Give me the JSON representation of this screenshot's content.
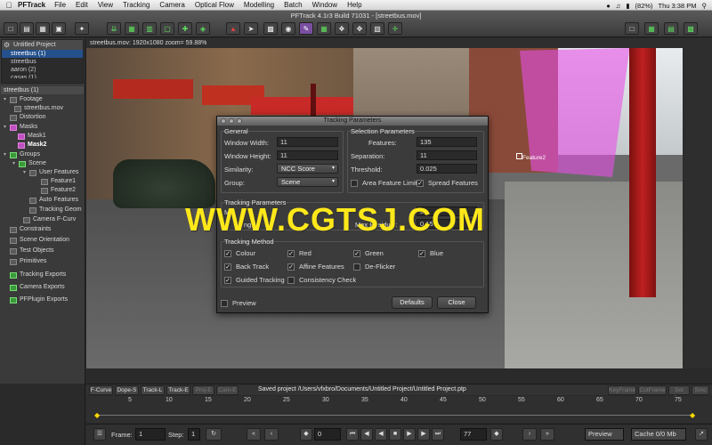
{
  "menubar": {
    "app": "PFTrack",
    "items": [
      "File",
      "Edit",
      "View",
      "Tracking",
      "Camera",
      "Optical Flow",
      "Modelling",
      "Batch",
      "Window",
      "Help"
    ],
    "battery": "(82%)",
    "clock": "Thu 3:38 PM"
  },
  "window": {
    "title": "PFTrack 4.1r3 Build 71031 - [streetbus.mov]"
  },
  "project": {
    "title": "Untitled Project",
    "items": [
      "streetbus (1)",
      "streetbus",
      "aaron (2)",
      "casas (1)"
    ]
  },
  "tree": {
    "header": "streetbus (1)",
    "nodes": [
      {
        "label": "Footage"
      },
      {
        "label": "streetbus.mov"
      },
      {
        "label": "Distortion"
      },
      {
        "label": "Masks"
      },
      {
        "label": "Mask1"
      },
      {
        "label": "Mask2"
      },
      {
        "label": "Groups"
      },
      {
        "label": "Scene"
      },
      {
        "label": "User Features"
      },
      {
        "label": "Feature1"
      },
      {
        "label": "Feature2"
      },
      {
        "label": "Auto Features"
      },
      {
        "label": "Tracking Geom"
      },
      {
        "label": "Camera F-Curv"
      },
      {
        "label": "Constraints"
      },
      {
        "label": "Scene Orientation"
      },
      {
        "label": "Test Objects"
      },
      {
        "label": "Primitives"
      },
      {
        "label": "Tracking Exports"
      },
      {
        "label": "Camera Exports"
      },
      {
        "label": "PFPlugin Exports"
      }
    ]
  },
  "viewport": {
    "header": "streetbus.mov: 1920x1080 zoom= 59.88%",
    "feature_label": "Feature2"
  },
  "dialog": {
    "title": "Tracking Parameters",
    "general": {
      "heading": "General",
      "window_width_label": "Window Width:",
      "window_width": "11",
      "window_height_label": "Window Height:",
      "window_height": "11",
      "similarity_label": "Similarity:",
      "similarity": "NCC Score",
      "group_label": "Group:",
      "group": "Scene"
    },
    "selection": {
      "heading": "Selection Parameters",
      "features_label": "Features:",
      "features": "135",
      "separation_label": "Separation:",
      "separation": "11",
      "threshold_label": "Threshold:",
      "threshold": "0.025",
      "area_limit_label": "Area Feature Limit",
      "spread_label": "Spread Features"
    },
    "tracking_params": {
      "heading": "Tracking Parameters",
      "min_label": "Min",
      "row2_partial": "ng",
      "val_partial": "2",
      "max_residual_label": "Max Residual:",
      "max_residual": "0.15"
    },
    "method": {
      "heading": "Tracking Method",
      "colour": "Colour",
      "red": "Red",
      "green": "Green",
      "blue": "Blue",
      "back_track": "Back Track",
      "affine": "Affine Features",
      "deflicker": "De-Flicker",
      "guided": "Guided Tracking",
      "consistency": "Consistency Check"
    },
    "preview_label": "Preview",
    "defaults_button": "Defaults",
    "close_button": "Close"
  },
  "watermark": "WWW.CGTSJ.COM",
  "bottombar": {
    "buttons_left": [
      "F-Curve",
      "Dope-S",
      "Track-L",
      "Track-E",
      "Proj-E",
      "Cam-E"
    ],
    "status": "Saved project /Users/vfxbro/Documents/Untitled Project/Untitled Project.ptp",
    "buttons_right": [
      "KeyFrame",
      "CutFrame",
      "Set Smc",
      "Smc"
    ]
  },
  "timeline": {
    "ticks": [
      "5",
      "10",
      "15",
      "20",
      "25",
      "30",
      "35",
      "40",
      "45",
      "50",
      "55",
      "60",
      "65",
      "70",
      "75"
    ]
  },
  "controls": {
    "frame_label": "Frame:",
    "frame": "1",
    "step_label": "Step:",
    "step": "1",
    "current": "0",
    "end": "77",
    "preview": "Preview",
    "cache": "Cache 0/0 Mb"
  }
}
